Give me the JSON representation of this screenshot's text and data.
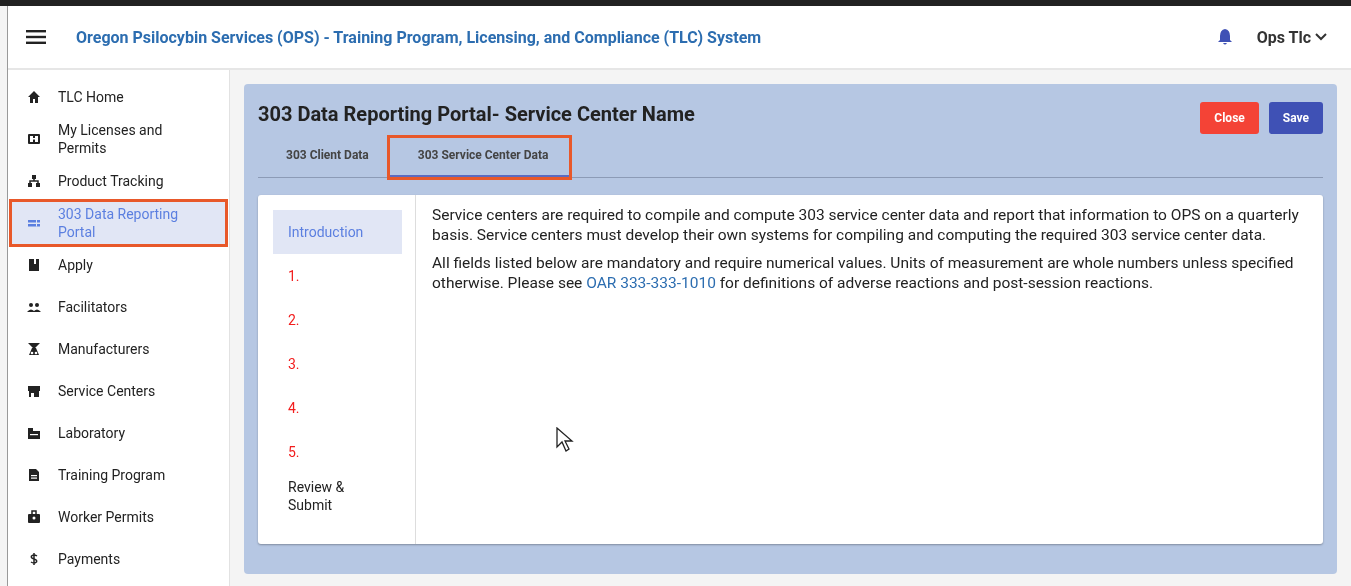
{
  "header": {
    "title": "Oregon Psilocybin Services (OPS) - Training Program, Licensing, and Compliance (TLC) System",
    "user": "Ops Tlc"
  },
  "sidebar": {
    "items": [
      {
        "label": "TLC Home",
        "selected": false,
        "highlighted": false
      },
      {
        "label": "My Licenses and Permits",
        "selected": false,
        "highlighted": false
      },
      {
        "label": "Product Tracking",
        "selected": false,
        "highlighted": false
      },
      {
        "label": "303 Data Reporting Portal",
        "selected": true,
        "highlighted": true
      },
      {
        "label": "Apply",
        "selected": false,
        "highlighted": false
      },
      {
        "label": "Facilitators",
        "selected": false,
        "highlighted": false
      },
      {
        "label": "Manufacturers",
        "selected": false,
        "highlighted": false
      },
      {
        "label": "Service Centers",
        "selected": false,
        "highlighted": false
      },
      {
        "label": "Laboratory",
        "selected": false,
        "highlighted": false
      },
      {
        "label": "Training Program",
        "selected": false,
        "highlighted": false
      },
      {
        "label": "Worker Permits",
        "selected": false,
        "highlighted": false
      },
      {
        "label": "Payments",
        "selected": false,
        "highlighted": false
      }
    ]
  },
  "panel": {
    "title": "303 Data Reporting Portal- Service Center Name",
    "buttons": [
      {
        "label": "Close",
        "kind": "danger"
      },
      {
        "label": "Save",
        "kind": "primary"
      }
    ],
    "tabs": [
      {
        "label": "303 Client Data",
        "selected": false,
        "highlighted": false
      },
      {
        "label": "303 Service Center Data",
        "selected": true,
        "highlighted": true
      }
    ],
    "steps": [
      {
        "label": "Introduction",
        "selected": true,
        "incomplete": false
      },
      {
        "label": "1.",
        "selected": false,
        "incomplete": true
      },
      {
        "label": "2.",
        "selected": false,
        "incomplete": true
      },
      {
        "label": "3.",
        "selected": false,
        "incomplete": true
      },
      {
        "label": "4.",
        "selected": false,
        "incomplete": true
      },
      {
        "label": "5.",
        "selected": false,
        "incomplete": true
      },
      {
        "label": "Review & Submit",
        "selected": false,
        "incomplete": false
      }
    ],
    "paragraphs": [
      {
        "text": "Service centers are required to compile and compute 303 service center data and report that information to OPS on a quarterly basis. Service centers must develop their own systems for compiling and computing the required 303 service center data."
      },
      {
        "text": "All fields listed below are mandatory and require numerical values. Units of measurement are whole numbers unless specified otherwise. Please see ",
        "link": "OAR 333-333-1010",
        "after": " for definitions of adverse reactions and post-session reactions."
      }
    ]
  }
}
